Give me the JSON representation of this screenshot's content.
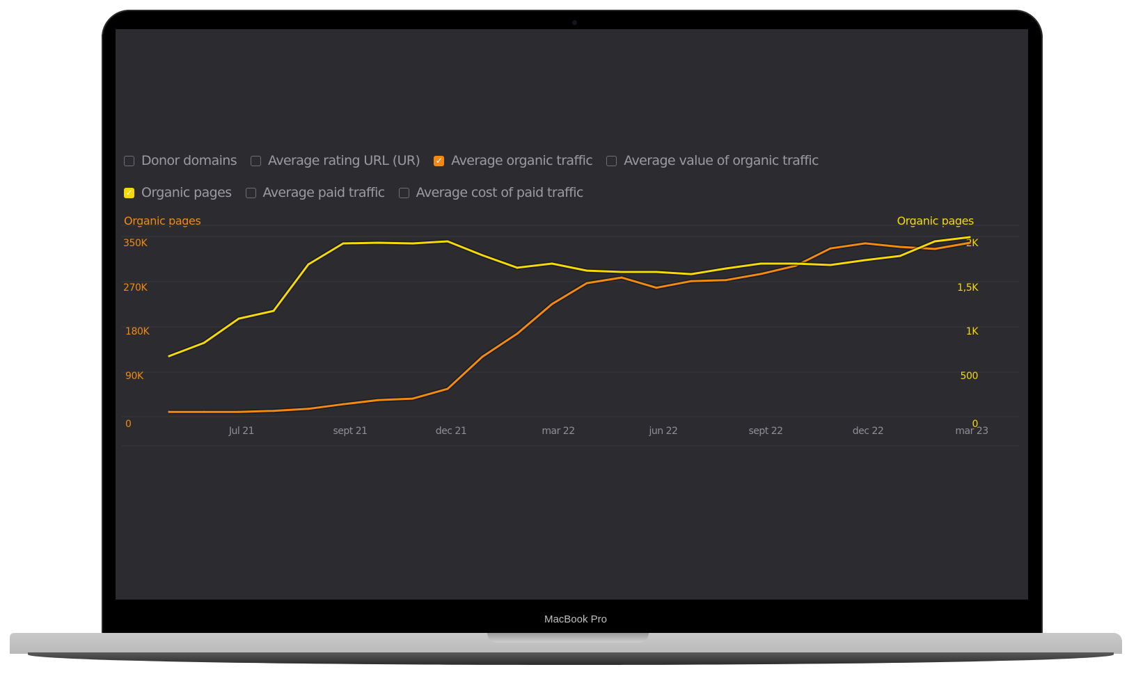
{
  "device": {
    "brand_label": "MacBook Pro"
  },
  "legend": {
    "row1": [
      {
        "label": "Donor domains",
        "checked": false,
        "color": ""
      },
      {
        "label": "Average rating URL (UR)",
        "checked": false,
        "color": ""
      },
      {
        "label": "Average organic traffic",
        "checked": true,
        "color": "#f08a12"
      },
      {
        "label": "Average value of organic traffic",
        "checked": false,
        "color": ""
      }
    ],
    "row2": [
      {
        "label": "Organic pages",
        "checked": true,
        "color": "#f5d90a"
      },
      {
        "label": "Average paid traffic",
        "checked": false,
        "color": ""
      },
      {
        "label": "Average cost of paid traffic",
        "checked": false,
        "color": ""
      }
    ]
  },
  "chart_data": {
    "type": "line",
    "title": "",
    "left_axis": {
      "label": "Organic pages",
      "ticks": [
        "350K",
        "270K",
        "180K",
        "90K",
        "0"
      ],
      "range": [
        0,
        350000
      ],
      "color": "#f08a12"
    },
    "right_axis": {
      "label": "Organic pages",
      "ticks": [
        "2K",
        "1,5K",
        "1K",
        "500",
        "0"
      ],
      "range": [
        0,
        2000
      ],
      "color": "#f5d90a"
    },
    "x_ticks": [
      "Jul 21",
      "sept 21",
      "dec 21",
      "mar 22",
      "jun 22",
      "sept 22",
      "dec 22",
      "mar 23"
    ],
    "grid": true,
    "series": [
      {
        "name": "Average organic traffic",
        "axis": "left",
        "color": "#f08a12",
        "values": [
          27000,
          27000,
          27000,
          29000,
          33000,
          42000,
          50000,
          53000,
          72000,
          135000,
          180000,
          238000,
          279000,
          290000,
          270000,
          283000,
          285000,
          297000,
          313000,
          347000,
          357000,
          350000,
          346000,
          358000
        ]
      },
      {
        "name": "Organic pages",
        "axis": "right",
        "color": "#f5d90a",
        "values": [
          778,
          926,
          1198,
          1284,
          1805,
          2039,
          2047,
          2039,
          2062,
          1907,
          1767,
          1813,
          1735,
          1720,
          1720,
          1696,
          1759,
          1813,
          1813,
          1798,
          1852,
          1899,
          2062,
          2109
        ]
      }
    ]
  }
}
